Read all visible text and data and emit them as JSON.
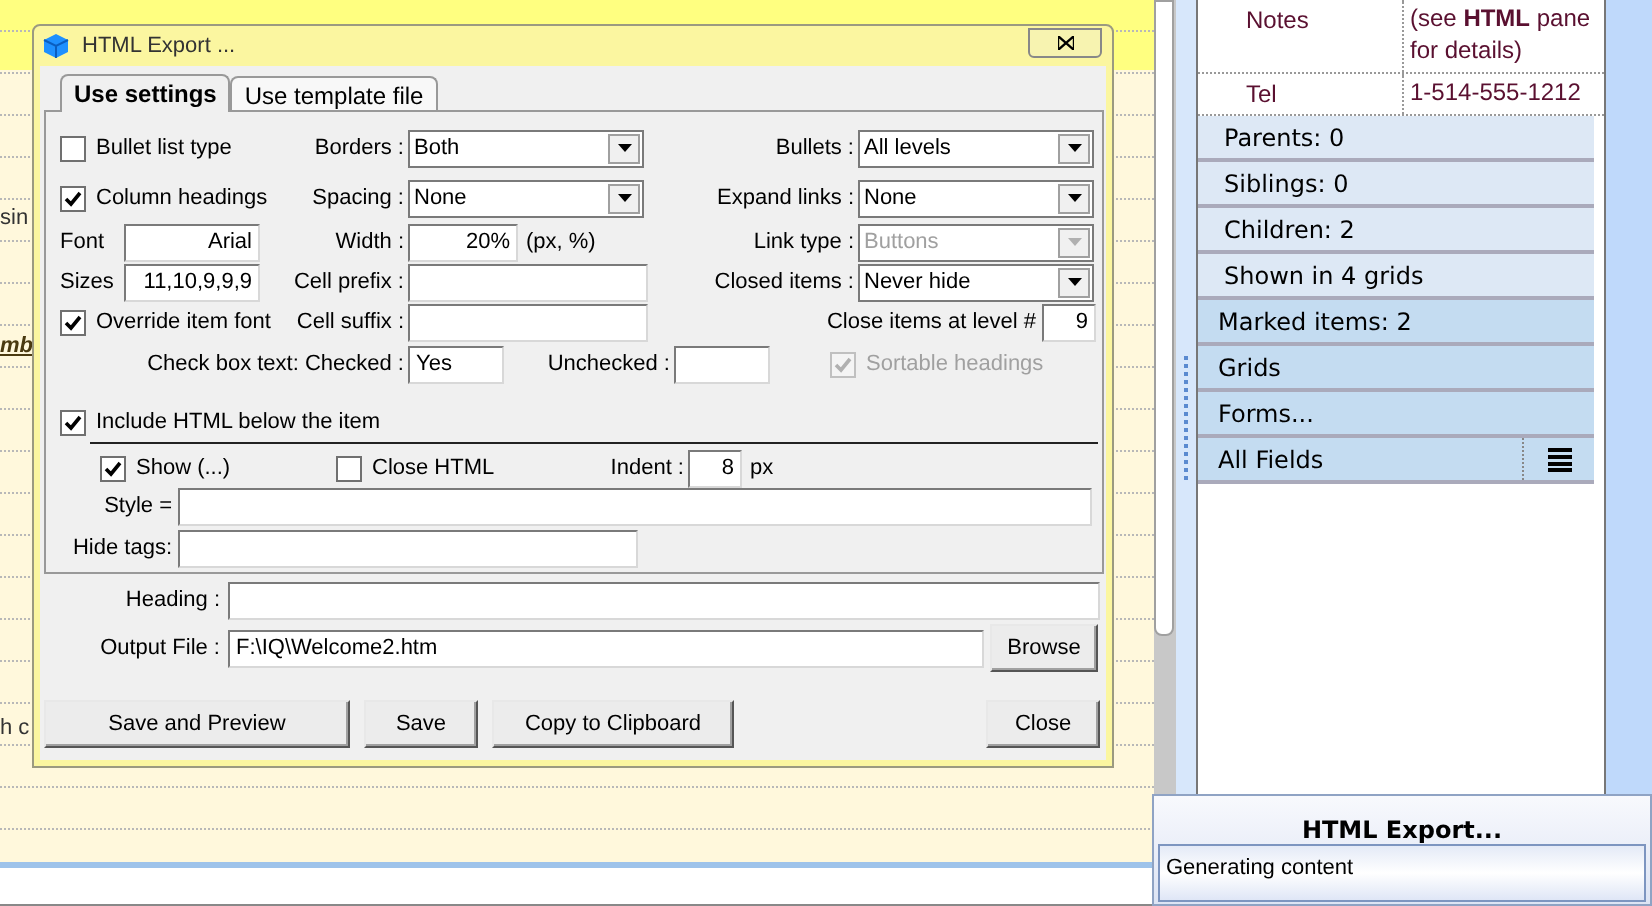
{
  "background_text": [
    {
      "text": "sin",
      "kind": "plain"
    },
    {
      "text": "mb",
      "kind": "link"
    },
    {
      "text": "h c",
      "kind": "plain"
    }
  ],
  "dialog": {
    "title": "HTML Export ...",
    "tabs": [
      {
        "label": "Use settings",
        "selected": true
      },
      {
        "label": "Use template file",
        "selected": false
      }
    ],
    "bullet_list_type": {
      "label": "Bullet list type",
      "checked": false
    },
    "column_headings": {
      "label": "Column headings",
      "checked": true
    },
    "font": {
      "label": "Font",
      "value": "Arial"
    },
    "sizes": {
      "label": "Sizes",
      "value": "11,10,9,9,9"
    },
    "override_item_font": {
      "label": "Override item font",
      "checked": true
    },
    "borders": {
      "label": "Borders :",
      "value": "Both"
    },
    "spacing": {
      "label": "Spacing :",
      "value": "None"
    },
    "width": {
      "label": "Width :",
      "value": "20%",
      "unit": "(px, %)"
    },
    "cell_prefix": {
      "label": "Cell prefix :"
    },
    "cell_suffix": {
      "label": "Cell suffix :"
    },
    "bullets": {
      "label": "Bullets :",
      "value": "All levels"
    },
    "expand_links": {
      "label": "Expand links :",
      "value": "None"
    },
    "link_type": {
      "label": "Link type :",
      "value": "Buttons",
      "disabled": true
    },
    "closed_items": {
      "label": "Closed items :",
      "value": "Never hide"
    },
    "close_items_at_level": {
      "label": "Close items at level #",
      "value": "9"
    },
    "checked_text": {
      "label": "Check box text: Checked :",
      "value": "Yes"
    },
    "unchecked_text": {
      "label": "Unchecked :"
    },
    "sortable_headings": {
      "label": "Sortable headings",
      "checked": true,
      "disabled": true
    },
    "include_html": {
      "label": "Include HTML below the item",
      "checked": true
    },
    "show": {
      "label": "Show (...)",
      "checked": true
    },
    "close_html": {
      "label": "Close HTML",
      "checked": false
    },
    "indent": {
      "label": "Indent :",
      "value": "8",
      "unit": "px"
    },
    "style": {
      "label": "Style ="
    },
    "hide_tags": {
      "label": "Hide tags:"
    },
    "heading": {
      "label": "Heading :"
    },
    "output_file": {
      "label": "Output File :",
      "value": "F:\\IQ\\Welcome2.htm"
    },
    "browse_button": "Browse",
    "buttons": [
      "Save and Preview",
      "Save",
      "Copy to Clipboard"
    ],
    "close_button": "Close"
  },
  "details": [
    {
      "label": "Notes",
      "value": "(see **HTML** pane for details)"
    },
    {
      "label": "Tel",
      "value": "1-514-555-1212"
    }
  ],
  "sections": [
    {
      "label": "Parents: 0",
      "kind": "info"
    },
    {
      "label": "Siblings: 0",
      "kind": "info"
    },
    {
      "label": "Children: 2",
      "kind": "info"
    },
    {
      "label": "Shown in 4 grids",
      "kind": "info"
    },
    {
      "label": "Marked items: 2",
      "kind": "group"
    },
    {
      "label": "Grids",
      "kind": "group"
    },
    {
      "label": "Forms...",
      "kind": "group"
    },
    {
      "label": "All Fields",
      "kind": "menu"
    }
  ],
  "progress_popup": {
    "title": "HTML Export...",
    "message": "Generating content"
  }
}
